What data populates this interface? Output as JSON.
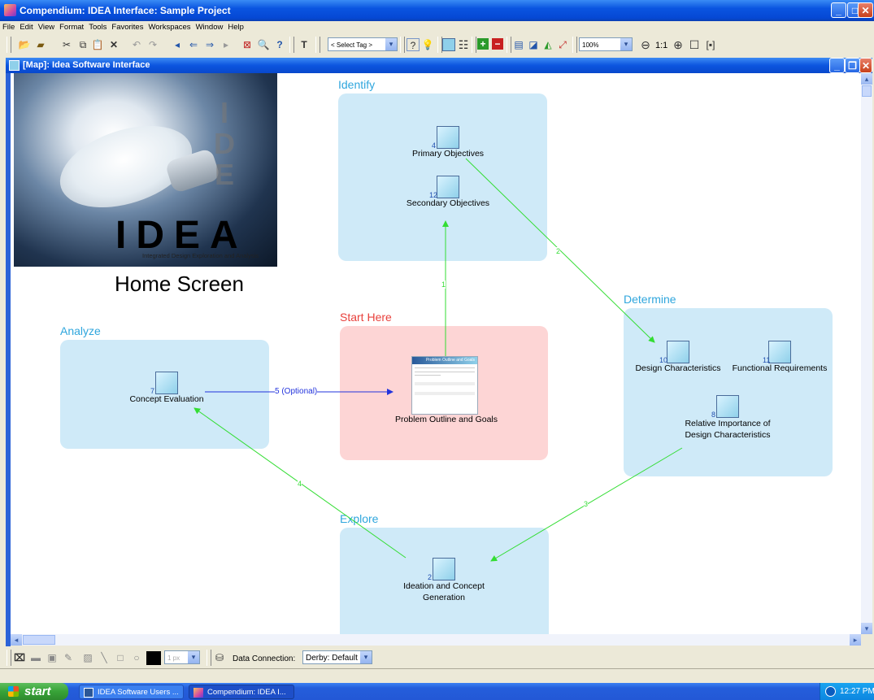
{
  "window": {
    "title": "Compendium: IDEA Interface: Sample Project"
  },
  "menu": [
    "File",
    "Edit",
    "View",
    "Format",
    "Tools",
    "Favorites",
    "Workspaces",
    "Window",
    "Help"
  ],
  "toolbar": {
    "tag_select": "< Select Tag >",
    "zoom": "100%",
    "zoom_actual": "1:1"
  },
  "map": {
    "title": "[Map]: Idea Software Interface",
    "logo": {
      "letters": "IDEA",
      "subtitle": "Integrated Design Exploration and Analysis",
      "vertical_letters": "IDE"
    },
    "home_label": "Home Screen",
    "regions": {
      "identify": {
        "label": "Identify"
      },
      "start": {
        "label": "Start Here"
      },
      "determine": {
        "label": "Determine"
      },
      "analyze": {
        "label": "Analyze"
      },
      "explore": {
        "label": "Explore"
      }
    },
    "nodes": [
      {
        "count": "4",
        "label": "Primary Objectives"
      },
      {
        "count": "12",
        "label": "Secondary Objectives"
      },
      {
        "count": "",
        "label": "Problem Outline and Goals"
      },
      {
        "count": "10",
        "label": "Design Characteristics"
      },
      {
        "count": "11",
        "label": "Functional Requirements"
      },
      {
        "count": "8",
        "label": "Relative Importance of Design Characteristics"
      },
      {
        "count": "7",
        "label": "Concept Evaluation"
      },
      {
        "count": "2",
        "label": "Ideation and Concept Generation"
      }
    ],
    "thumb_title": "Problem Outline and Goals",
    "links": [
      "1",
      "2",
      "3",
      "4",
      "5 (Optional)"
    ],
    "colors": {
      "region_blue": "#cfeaf8",
      "region_red": "#fdd5d5",
      "label_blue": "#2fa6dd",
      "label_red": "#e8413c",
      "link_green": "#33dd33",
      "link_blue": "#2233dd"
    }
  },
  "bottom": {
    "px": "1 px",
    "connection_label": "Data Connection:",
    "connection_value": "Derby: Default"
  },
  "taskbar": {
    "start": "start",
    "tasks": [
      "IDEA Software Users ...",
      "Compendium: IDEA I..."
    ],
    "time": "12:27 PM"
  }
}
